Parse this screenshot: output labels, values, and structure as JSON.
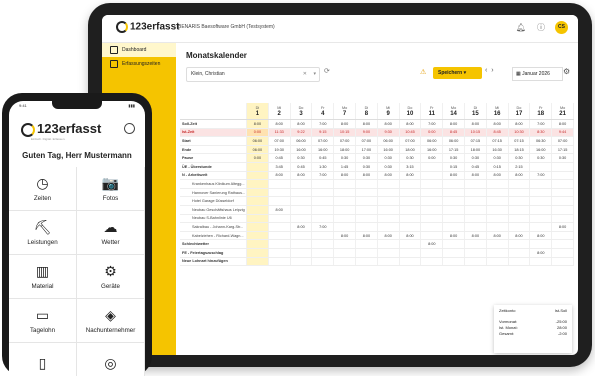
{
  "tablet": {
    "logo": "123erfasst",
    "company": "BENARIS Baesoftware GmbH (Testsystem)",
    "avatar": "CS",
    "sidebar": [
      "Dashboard",
      "Erfassungszeiten",
      "",
      "",
      "",
      "",
      ""
    ],
    "title": "Monatskalender",
    "filter": "Klein, Christian",
    "save_label": "Speichern",
    "month": "Januar 2026",
    "days": [
      {
        "wd": "Di",
        "n": "1"
      },
      {
        "wd": "Mi",
        "n": "2"
      },
      {
        "wd": "Do",
        "n": "3"
      },
      {
        "wd": "Fr",
        "n": "4"
      },
      {
        "wd": "Mo",
        "n": "7"
      },
      {
        "wd": "Di",
        "n": "8"
      },
      {
        "wd": "Mi",
        "n": "9"
      },
      {
        "wd": "Do",
        "n": "10"
      },
      {
        "wd": "Fr",
        "n": "11"
      },
      {
        "wd": "Mo",
        "n": "14"
      },
      {
        "wd": "Di",
        "n": "15"
      },
      {
        "wd": "Mi",
        "n": "16"
      },
      {
        "wd": "Do",
        "n": "17"
      },
      {
        "wd": "Fr",
        "n": "18"
      },
      {
        "wd": "Mo",
        "n": "21"
      }
    ],
    "rows": [
      {
        "label": "Soll-Zeit",
        "type": "lbl",
        "cells": [
          "8:00",
          "8:00",
          "8:00",
          "7:00",
          "8:00",
          "8:00",
          "8:00",
          "8:00",
          "7:00",
          "8:00",
          "8:00",
          "8:00",
          "8:00",
          "7:00",
          "8:00"
        ]
      },
      {
        "label": "Ist-Zeit",
        "type": "red",
        "cells": [
          "0:00",
          "11:33",
          "9:22",
          "9:15",
          "10:15",
          "9:00",
          "9:30",
          "10:45",
          "0:00",
          "8:45",
          "10:15",
          "8:45",
          "10:30",
          "8:30",
          "9:44"
        ]
      },
      {
        "label": "Start",
        "type": "lbl",
        "cells": [
          "06:00",
          "07:00",
          "06:00",
          "07:00",
          "07:00",
          "07:00",
          "06:00",
          "07:00",
          "06:00",
          "06:00",
          "07:15",
          "07:15",
          "07:15",
          "06:30",
          "07:00"
        ]
      },
      {
        "label": "Ende",
        "type": "lbl",
        "cells": [
          "06:00",
          "19:30",
          "16:00",
          "16:00",
          "18:00",
          "17:00",
          "16:00",
          "18:00",
          "16:00",
          "17:15",
          "18:00",
          "16:30",
          "18:15",
          "16:00",
          "17:15"
        ]
      },
      {
        "label": "Pause",
        "type": "lbl",
        "cells": [
          "0:00",
          "0:45",
          "0:30",
          "0:45",
          "0:30",
          "0:30",
          "0:30",
          "0:30",
          "0:00",
          "0:30",
          "0:30",
          "0:30",
          "0:30",
          "0:30",
          "0:30"
        ]
      },
      {
        "label": "ÜE - Überstunde",
        "type": "lbl",
        "cells": [
          "",
          "3:45",
          "0:45",
          "1:30",
          "1:45",
          "0:30",
          "0:30",
          "3:15",
          "",
          "0:15",
          "0:45",
          "0:15",
          "2:15",
          "",
          ""
        ]
      },
      {
        "label": "N - Arbeitszeit",
        "type": "lbl",
        "cells": [
          "",
          "8:00",
          "8:00",
          "7:00",
          "8:00",
          "8:00",
          "8:00",
          "8:00",
          "",
          "8:00",
          "8:00",
          "8:00",
          "8:00",
          "7:00",
          ""
        ]
      },
      {
        "label": "Krankenhaus Klinikum Altegg...",
        "type": "proj",
        "cells": [
          "",
          "",
          "",
          "",
          "",
          "",
          "",
          "",
          "",
          "",
          "",
          "",
          "",
          "",
          ""
        ]
      },
      {
        "label": "Hannover Sanierung Rathaus...",
        "type": "proj",
        "cells": [
          "",
          "",
          "",
          "",
          "",
          "",
          "",
          "",
          "",
          "",
          "",
          "",
          "",
          "",
          ""
        ]
      },
      {
        "label": "Hotel Garage Düsseldorf",
        "type": "proj",
        "cells": [
          "",
          "",
          "",
          "",
          "",
          "",
          "",
          "",
          "",
          "",
          "",
          "",
          "",
          "",
          ""
        ]
      },
      {
        "label": "Neubau Geschäftshaus Leipzig",
        "type": "proj",
        "cells": [
          "",
          "8:00",
          "",
          "",
          "",
          "",
          "",
          "",
          "",
          "",
          "",
          "",
          "",
          "",
          ""
        ]
      },
      {
        "label": "Neubau S-Bahnlinie U6",
        "type": "proj",
        "cells": [
          "",
          "",
          "",
          "",
          "",
          "",
          "",
          "",
          "",
          "",
          "",
          "",
          "",
          "",
          ""
        ]
      },
      {
        "label": "Sakralbau - Johann-Karg-Str...",
        "type": "proj",
        "cells": [
          "",
          "",
          "8:00",
          "7:00",
          "",
          "",
          "",
          "",
          "",
          "",
          "",
          "",
          "",
          "",
          "8:00"
        ]
      },
      {
        "label": "Kabelziehen - Richard-Wagn...",
        "type": "proj",
        "cells": [
          "",
          "",
          "",
          "",
          "8:00",
          "8:00",
          "8:00",
          "8:00",
          "",
          "8:00",
          "8:00",
          "8:00",
          "8:00",
          "8:00",
          ""
        ]
      },
      {
        "label": "Schlechtwetter",
        "type": "lbl",
        "cells": [
          "",
          "",
          "",
          "",
          "",
          "",
          "",
          "",
          "8:00",
          "",
          "",
          "",
          "",
          "",
          ""
        ]
      },
      {
        "label": "FE - Feiertagszuschlag",
        "type": "lbl",
        "cells": [
          "",
          "",
          "",
          "",
          "",
          "",
          "",
          "",
          "",
          "",
          "",
          "",
          "",
          "8:00",
          ""
        ]
      },
      {
        "label": "Neue Lohnart hinzufügen",
        "type": "lbl",
        "cells": [
          "",
          "",
          "",
          "",
          "",
          "",
          "",
          "",
          "",
          "",
          "",
          "",
          "",
          "",
          ""
        ]
      }
    ],
    "summary": {
      "title_l": "Zeitkonto",
      "title_r": "Ist-Soll",
      "r1_l": "Vormonat:",
      "r1_r": "-25:00",
      "r2_l": "Ist. Monat:",
      "r2_r": "28:00",
      "r3_l": "Gesamt:",
      "r3_r": "-2:00"
    }
  },
  "phone": {
    "time": "9:41",
    "logo": "123erfasst",
    "tagline": "Einfach. Digital. Erfassen.",
    "greeting": "Guten Tag, Herr Mustermann",
    "tiles": [
      {
        "icon": "clock-icon",
        "glyph": "◷",
        "label": "Zeiten"
      },
      {
        "icon": "camera-icon",
        "glyph": "📷",
        "label": "Fotos"
      },
      {
        "icon": "worker-icon",
        "glyph": "⛏",
        "label": "Leistungen"
      },
      {
        "icon": "weather-icon",
        "glyph": "☁",
        "label": "Wetter"
      },
      {
        "icon": "material-icon",
        "glyph": "▥",
        "label": "Material"
      },
      {
        "icon": "machine-icon",
        "glyph": "⚙",
        "label": "Geräte"
      },
      {
        "icon": "wage-icon",
        "glyph": "▭",
        "label": "Tagelohn"
      },
      {
        "icon": "subcontractor-icon",
        "glyph": "◈",
        "label": "Nachunternehmer"
      },
      {
        "icon": "document-icon",
        "glyph": "▯",
        "label": ""
      },
      {
        "icon": "report-icon",
        "glyph": "◎",
        "label": ""
      }
    ]
  }
}
